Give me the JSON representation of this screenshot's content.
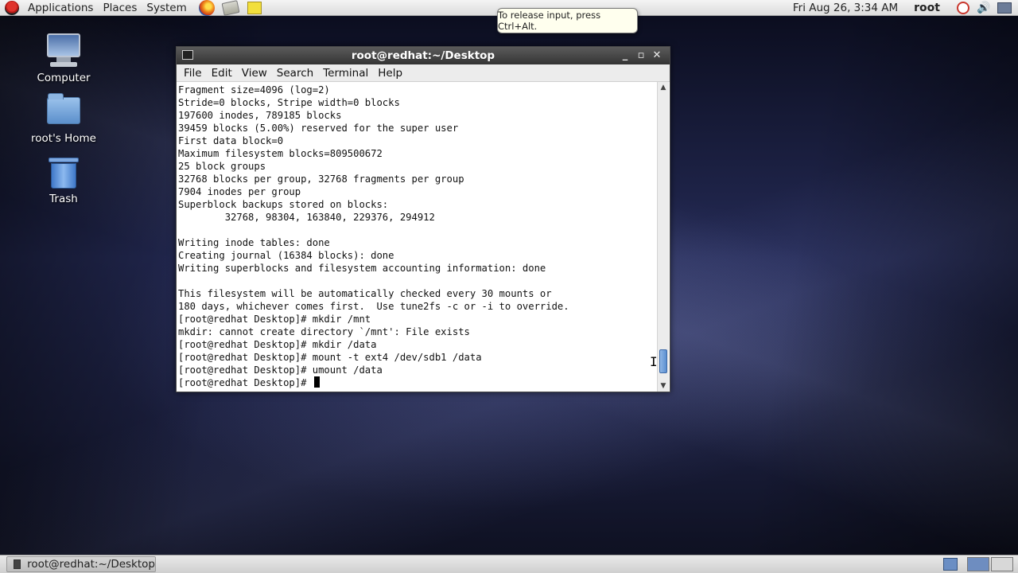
{
  "top_panel": {
    "menus": [
      "Applications",
      "Places",
      "System"
    ],
    "launchers": [
      "firefox-icon",
      "manual-icon",
      "notes-icon"
    ],
    "clock": "Fri Aug 26,  3:34 AM",
    "user": "root",
    "tray": [
      "power-icon",
      "volume-icon",
      "network-icon"
    ]
  },
  "tooltip": "To release input, press Ctrl+Alt.",
  "desktop_icons": [
    {
      "label": "Computer",
      "icon": "computer-icon"
    },
    {
      "label": "root's Home",
      "icon": "home-folder-icon"
    },
    {
      "label": "Trash",
      "icon": "trash-icon"
    }
  ],
  "terminal": {
    "title": "root@redhat:~/Desktop",
    "menu": [
      "File",
      "Edit",
      "View",
      "Search",
      "Terminal",
      "Help"
    ],
    "lines": [
      "Fragment size=4096 (log=2)",
      "Stride=0 blocks, Stripe width=0 blocks",
      "197600 inodes, 789185 blocks",
      "39459 blocks (5.00%) reserved for the super user",
      "First data block=0",
      "Maximum filesystem blocks=809500672",
      "25 block groups",
      "32768 blocks per group, 32768 fragments per group",
      "7904 inodes per group",
      "Superblock backups stored on blocks:",
      "        32768, 98304, 163840, 229376, 294912",
      "",
      "Writing inode tables: done",
      "Creating journal (16384 blocks): done",
      "Writing superblocks and filesystem accounting information: done",
      "",
      "This filesystem will be automatically checked every 30 mounts or",
      "180 days, whichever comes first.  Use tune2fs -c or -i to override.",
      "[root@redhat Desktop]# mkdir /mnt",
      "mkdir: cannot create directory `/mnt': File exists",
      "[root@redhat Desktop]# mkdir /data",
      "[root@redhat Desktop]# mount -t ext4 /dev/sdb1 /data",
      "[root@redhat Desktop]# umount /data"
    ],
    "prompt": "[root@redhat Desktop]# "
  },
  "bottom_panel": {
    "task": "root@redhat:~/Desktop"
  }
}
